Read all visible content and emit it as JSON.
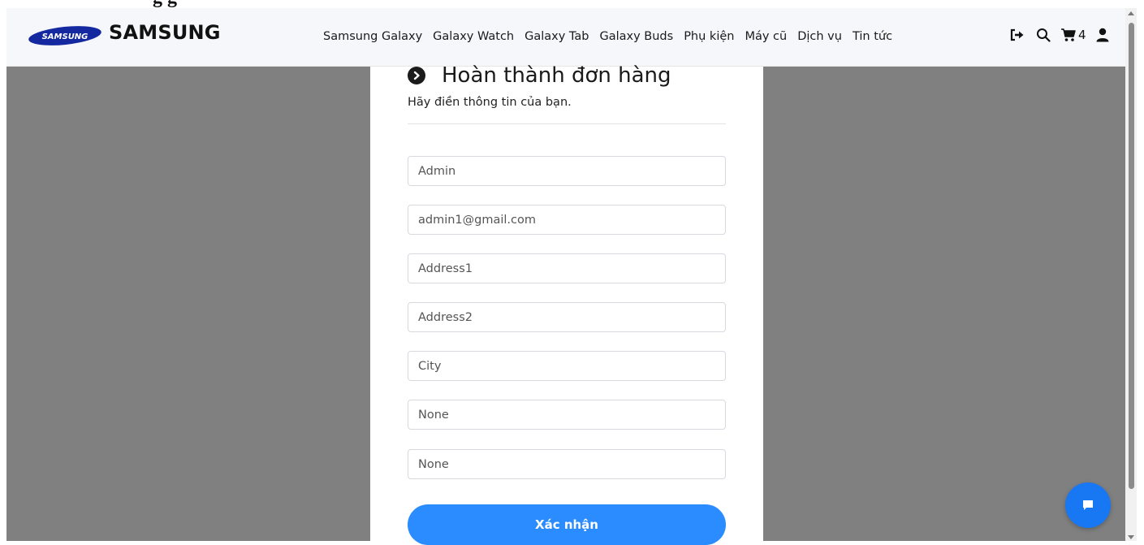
{
  "page_top_text": "g g",
  "header": {
    "logo_text": "SAMSUNG",
    "brand": "SAMSUNG",
    "nav": [
      {
        "label": "Samsung Galaxy"
      },
      {
        "label": "Galaxy Watch"
      },
      {
        "label": "Galaxy Tab"
      },
      {
        "label": "Galaxy Buds"
      },
      {
        "label": "Phụ kiện"
      },
      {
        "label": "Máy cũ"
      },
      {
        "label": "Dịch vụ"
      },
      {
        "label": "Tin tức"
      }
    ],
    "icons": [
      "sign-out-icon",
      "search-icon",
      "cart-icon",
      "user-icon"
    ],
    "cart_count": "4"
  },
  "form": {
    "title": "Hoàn thành đơn hàng",
    "subtitle": "Hãy điền thông tin của bạn.",
    "fields": [
      {
        "placeholder": "Admin"
      },
      {
        "placeholder": "admin1@gmail.com"
      },
      {
        "placeholder": "Address1"
      },
      {
        "placeholder": "Address2"
      },
      {
        "placeholder": "City"
      },
      {
        "placeholder": "None"
      },
      {
        "placeholder": "None"
      }
    ],
    "submit_label": "Xác nhận"
  },
  "colors": {
    "primary": "#2b8cff",
    "chat": "#1877f2",
    "overlay": "#808080",
    "navbar": "#f6f7fa",
    "logo": "#1428a0"
  }
}
